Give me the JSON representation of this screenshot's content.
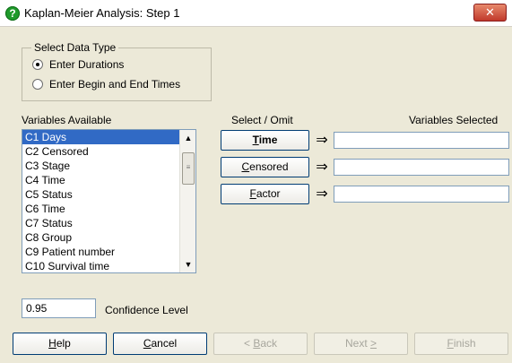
{
  "window": {
    "title": "Kaplan-Meier Analysis: Step 1",
    "close_glyph": "✕"
  },
  "data_type": {
    "legend": "Select Data Type",
    "options": [
      {
        "label": "Enter Durations",
        "checked": true
      },
      {
        "label": "Enter Begin and End Times",
        "checked": false
      }
    ]
  },
  "headers": {
    "variables_available": "Variables Available",
    "select_omit": "Select / Omit",
    "variables_selected": "Variables Selected"
  },
  "variables": [
    "C1 Days",
    "C2 Censored",
    "C3 Stage",
    "C4 Time",
    "C5 Status",
    "C6 Time",
    "C7 Status",
    "C8 Group",
    "C9 Patient number",
    "C10 Survival time"
  ],
  "selected_variable_index": 0,
  "role_buttons": [
    {
      "key": "T",
      "rest": "ime",
      "value": ""
    },
    {
      "key": "C",
      "rest": "ensored",
      "value": ""
    },
    {
      "key": "F",
      "rest": "actor",
      "value": ""
    }
  ],
  "arrow_glyph": "⇒",
  "confidence": {
    "value": "0.95",
    "label": "Confidence Level"
  },
  "buttons": {
    "help": {
      "key": "H",
      "rest": "elp"
    },
    "cancel": {
      "key": "C",
      "rest": "ancel"
    },
    "back": {
      "pre": "< ",
      "key": "B",
      "rest": "ack",
      "disabled": true
    },
    "next": {
      "pre": "Next ",
      "key": ">",
      "rest": "",
      "disabled": true
    },
    "finish": {
      "key": "F",
      "rest": "inish",
      "disabled": true
    }
  },
  "colors": {
    "selection": "#316ac5",
    "dialog_bg": "#ece9d8",
    "help_icon": "#1f9a2b",
    "close_button": "#c0392b"
  }
}
